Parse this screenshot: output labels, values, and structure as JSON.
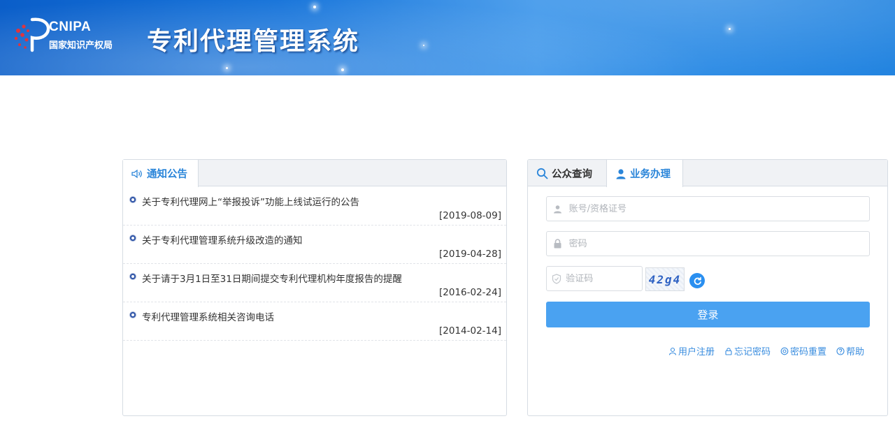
{
  "header": {
    "logo_en": "CNIPA",
    "logo_cn": "国家知识产权局",
    "system_title": "专利代理管理系统"
  },
  "notice": {
    "tab_label": "通知公告",
    "items": [
      {
        "title": "关于专利代理网上“举报投诉”功能上线试运行的公告",
        "date": "[2019-08-09]"
      },
      {
        "title": "关于专利代理管理系统升级改造的通知",
        "date": "[2019-04-28]"
      },
      {
        "title": "关于请于3月1日至31日期间提交专利代理机构年度报告的提醒",
        "date": "[2016-02-24]"
      },
      {
        "title": "专利代理管理系统相关咨询电话",
        "date": "[2014-02-14]"
      }
    ]
  },
  "login": {
    "tab_query": "公众查询",
    "tab_business": "业务办理",
    "account_placeholder": "账号/资格证号",
    "password_placeholder": "密码",
    "code_placeholder": "验证码",
    "captcha_text": "42g4",
    "submit_label": "登录",
    "links": {
      "register": "用户注册",
      "forgot": "忘记密码",
      "reset": "密码重置",
      "help": "帮助"
    }
  },
  "colors": {
    "accent": "#2a85d9",
    "button": "#4aa2f1",
    "banner": "#1b78dc"
  }
}
